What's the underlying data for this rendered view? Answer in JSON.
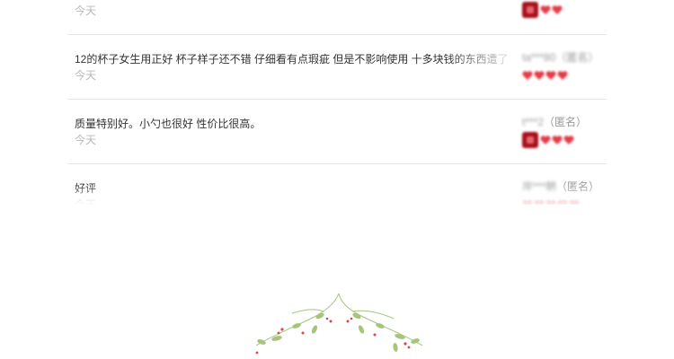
{
  "reviews": [
    {
      "content": "",
      "date": "今天",
      "user": "",
      "anon": "",
      "hearts": 2,
      "square": true
    },
    {
      "content": "12的杯子女生用正好 杯子样子还不错 仔细看有点瑕疵 但是不影响使用 十多块钱的东西遭了",
      "date": "今天",
      "user": "ta***80",
      "anon": "（匿名）",
      "hearts": 4,
      "square": false
    },
    {
      "content": "质量特别好。小勺也很好 性价比很高。",
      "date": "今天",
      "user": "t***2",
      "anon": "（匿名）",
      "hearts": 3,
      "square": true
    },
    {
      "content": "好评",
      "date": "今天",
      "user": "岸***朝",
      "anon": "（匿名）",
      "hearts": 5,
      "square": false
    }
  ],
  "colors": {
    "divider": "#e6e6e6",
    "heart": "#e23b47",
    "level": "#a6101c",
    "vine": "#a6c47a",
    "berry": "#d8474d"
  }
}
